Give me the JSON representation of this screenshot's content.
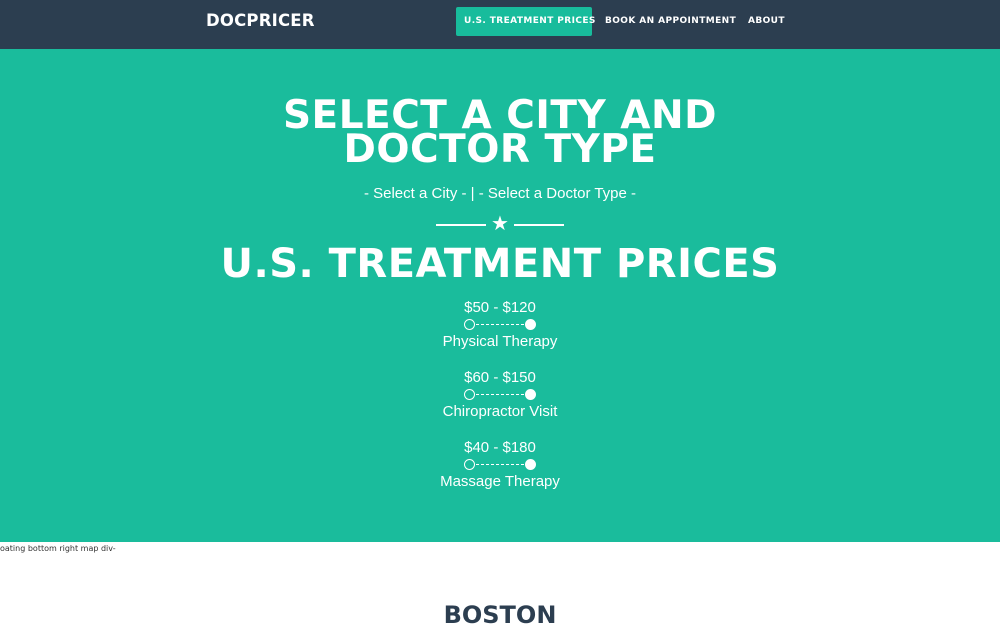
{
  "navbar": {
    "brand": "DOCPRICER",
    "items": [
      {
        "label": "U.S. TREATMENT PRICES",
        "active": true
      },
      {
        "label": "BOOK AN APPOINTMENT",
        "active": false
      },
      {
        "label": "ABOUT",
        "active": false
      }
    ]
  },
  "hero": {
    "title_line1": "SELECT A CITY AND",
    "title_line2": "DOCTOR TYPE",
    "city_select": "- Select a City -",
    "separator": "|",
    "doctor_select": "- Select a Doctor Type -",
    "divider_icon": "star-icon",
    "section_title": "U.S. TREATMENT PRICES",
    "prices": [
      {
        "range": "$50 - $120",
        "treatment": "Physical Therapy"
      },
      {
        "range": "$60 - $150",
        "treatment": "Chiropractor Visit"
      },
      {
        "range": "$40 - $180",
        "treatment": "Massage Therapy"
      }
    ]
  },
  "map_note": "oating bottom right map div-",
  "city_section": {
    "title": "BOSTON"
  },
  "colors": {
    "navbar_bg": "#2c3e50",
    "accent": "#1abc9c",
    "active_nav": "#18bc9c",
    "text_dark": "#2c3e50"
  }
}
